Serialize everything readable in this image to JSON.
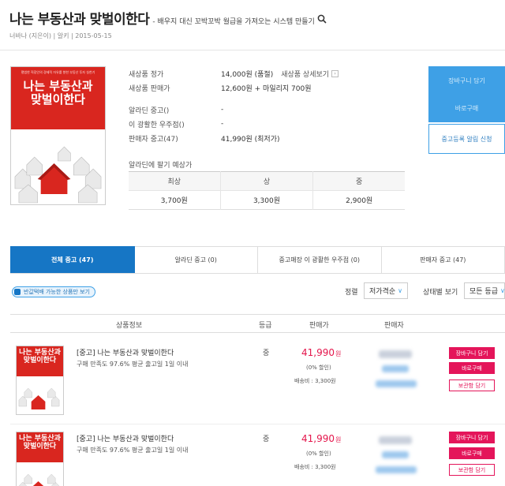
{
  "header": {
    "title": "나는 부동산과 맞벌이한다",
    "subtitle": "- 배우지 대신 꼬박꼬박 월급을 가져오는 시스템 만들기",
    "meta": "너바나 (지은이) | 알키 | 2015-05-15"
  },
  "cover": {
    "top_text": "평범한 직장인의 경제적 자유를 향한 부동산 투자 실천기",
    "title_line1": "나는 부동산과",
    "title_line2": "맞벌이한다"
  },
  "info": {
    "rows": [
      {
        "label": "새상품 정가",
        "value": "14,000원 (품절)",
        "link": "새상품 상세보기"
      },
      {
        "label": "새상품 판매가",
        "value": "12,600원 + 마일리지 700원"
      },
      {
        "label": "알라딘 중고()",
        "value": "-"
      },
      {
        "label": "이 광활한 우주점()",
        "value": "-"
      },
      {
        "label": "판매자 중고(47)",
        "value": "41,990원 (최저가)"
      }
    ],
    "estimate_title": "알라딘에 팔기 예상가",
    "estimate_headers": [
      "최상",
      "상",
      "중"
    ],
    "estimate_values": [
      "3,700원",
      "3,300원",
      "2,900원"
    ]
  },
  "side_buttons": {
    "btn1": "장바구니 담기",
    "btn2": "바로구매",
    "notify": "중고등록 알림 신청"
  },
  "tabs": [
    "전체 중고 (47)",
    "알라딘 중고 (0)",
    "중고매장 이 광활한 우주점 (0)",
    "판매자 중고 (47)"
  ],
  "filters": {
    "checkbox_label": "반값택배 가능한 상품만 보기",
    "sort_label": "정렬",
    "sort_value": "저가격순",
    "condition_label": "상태별 보기",
    "condition_value": "모든 등급"
  },
  "list_headers": {
    "product": "상품정보",
    "grade": "등급",
    "price": "판매가",
    "seller": "판매자"
  },
  "items": [
    {
      "title": "[중고] 나는 부동산과 맞벌이한다",
      "sub": "구매 만족도 97.6%    평균 출고일 1일 이내",
      "grade": "중",
      "price": "41,990",
      "unit": "원",
      "discount": "(0% 할인)",
      "shipping": "배송비 : 3,300원",
      "actions": [
        "장바구니 담기",
        "바로구매",
        "보관함 담기"
      ]
    },
    {
      "title": "[중고] 나는 부동산과 맞벌이한다",
      "sub": "구매 만족도 97.6%    평균 출고일 1일 이내",
      "grade": "중",
      "price": "41,990",
      "unit": "원",
      "discount": "(0% 할인)",
      "shipping": "배송비 : 3,300원",
      "actions": [
        "장바구니 담기",
        "바로구매",
        "보관함 담기"
      ]
    }
  ],
  "colors": {
    "accent_blue": "#1676c5",
    "button_blue": "#3ea0e6",
    "price_pink": "#e4154b",
    "cover_red": "#d9261f"
  },
  "icons": {
    "search": "search-icon"
  }
}
